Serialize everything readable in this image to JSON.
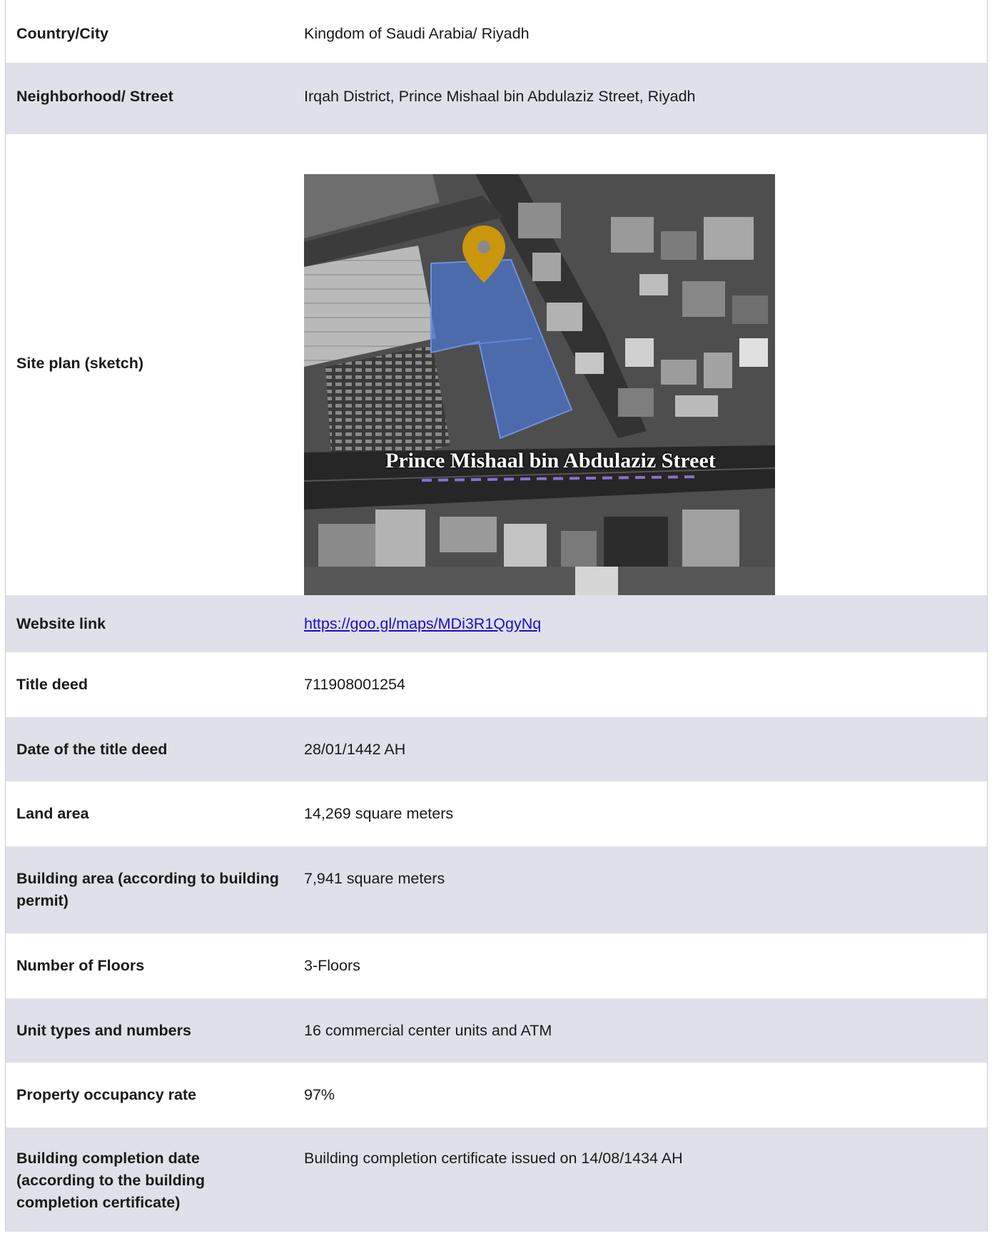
{
  "rows": [
    {
      "label": "Country/City",
      "value": "Kingdom of Saudi Arabia/ Riyadh"
    },
    {
      "label": "Neighborhood/ Street",
      "value": "Irqah District, Prince Mishaal bin Abdulaziz Street, Riyadh"
    },
    {
      "label": "Site plan (sketch)",
      "map_street_label": "Prince Mishaal bin Abdulaziz Street"
    },
    {
      "label": "Website link",
      "value": "https://goo.gl/maps/MDi3R1QgyNq"
    },
    {
      "label": "Title deed",
      "value": "711908001254"
    },
    {
      "label": "Date of the title deed",
      "value": "28/01/1442 AH"
    },
    {
      "label": "Land area",
      "value": "14,269 square meters"
    },
    {
      "label": "Building area (according to building permit)",
      "value": "7,941 square meters"
    },
    {
      "label": "Number of Floors",
      "value": "3-Floors"
    },
    {
      "label": "Unit types and numbers",
      "value": "16 commercial center units and ATM"
    },
    {
      "label": "Property occupancy rate",
      "value": "97%"
    },
    {
      "label": "Building completion date (according to the building completion certificate)",
      "value": "Building completion certificate issued on 14/08/1434 AH"
    }
  ],
  "colors": {
    "row_alt": "#e0e0ea",
    "row_white": "#ffffff",
    "link": "#1a0dcc",
    "site_highlight": "#4a73c8",
    "location_pin": "#c9960c",
    "street_dash": "#8a6fd0"
  },
  "icons": {
    "pin": "location-pin-icon"
  }
}
